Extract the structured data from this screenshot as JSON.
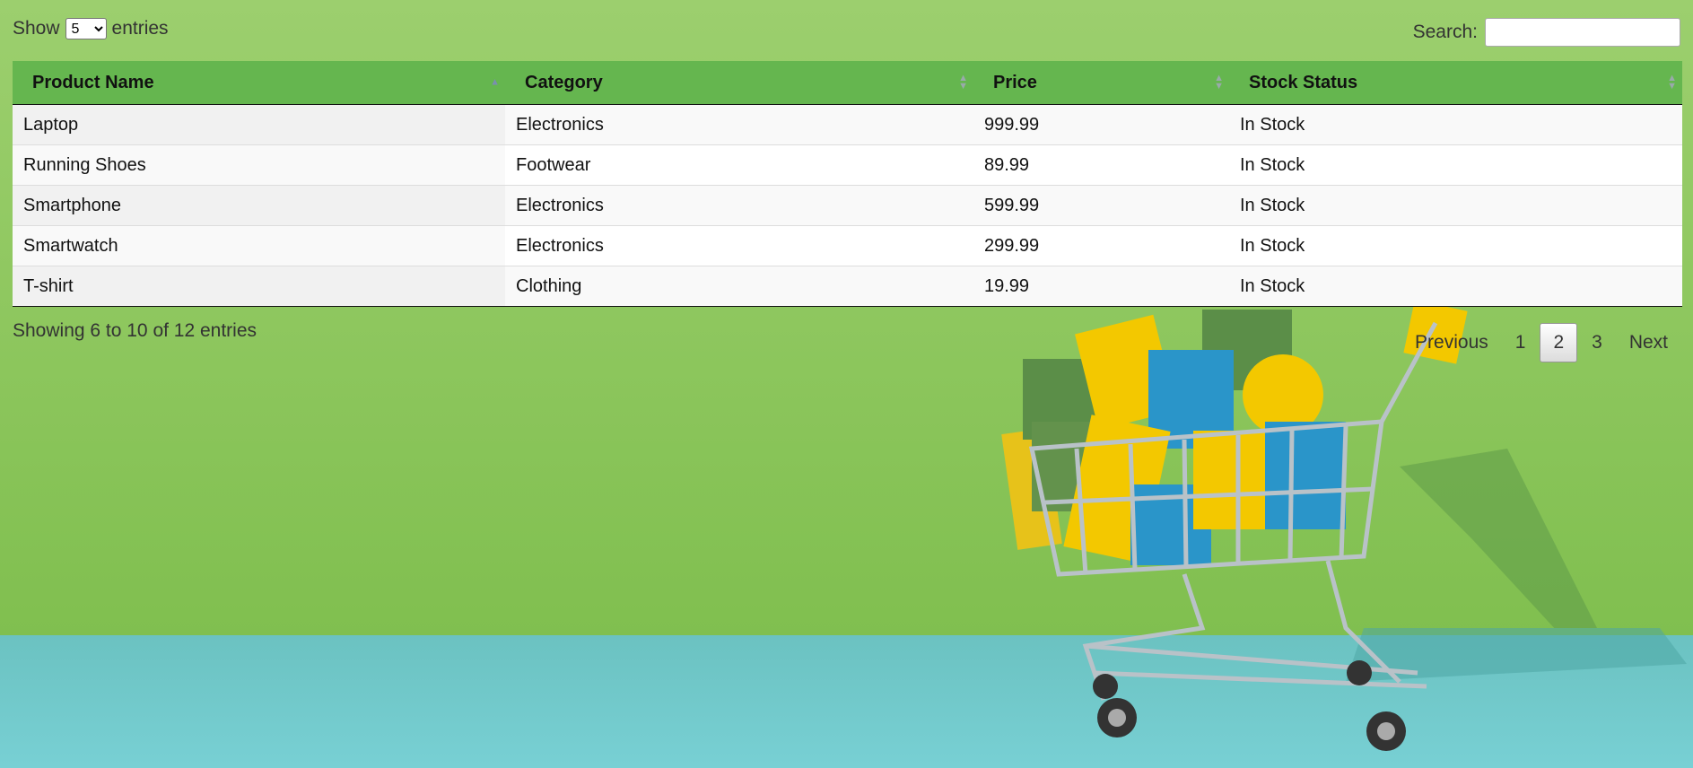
{
  "length": {
    "show_label": "Show",
    "entries_label": "entries",
    "selected": "5"
  },
  "search": {
    "label": "Search:",
    "value": ""
  },
  "table": {
    "columns": [
      "Product Name",
      "Category",
      "Price",
      "Stock Status"
    ],
    "rows": [
      [
        "Laptop",
        "Electronics",
        "999.99",
        "In Stock"
      ],
      [
        "Running Shoes",
        "Footwear",
        "89.99",
        "In Stock"
      ],
      [
        "Smartphone",
        "Electronics",
        "599.99",
        "In Stock"
      ],
      [
        "Smartwatch",
        "Electronics",
        "299.99",
        "In Stock"
      ],
      [
        "T-shirt",
        "Clothing",
        "19.99",
        "In Stock"
      ]
    ]
  },
  "info": "Showing 6 to 10 of 12 entries",
  "pagination": {
    "previous": "Previous",
    "pages": [
      "1",
      "2",
      "3"
    ],
    "current": "2",
    "next": "Next"
  },
  "colors": {
    "header": "#65b64f",
    "wall": "#8cc660",
    "floor": "#6fc8cc"
  },
  "icons": {
    "sort": "sort-both-icon",
    "sort_asc": "sort-asc-icon"
  }
}
